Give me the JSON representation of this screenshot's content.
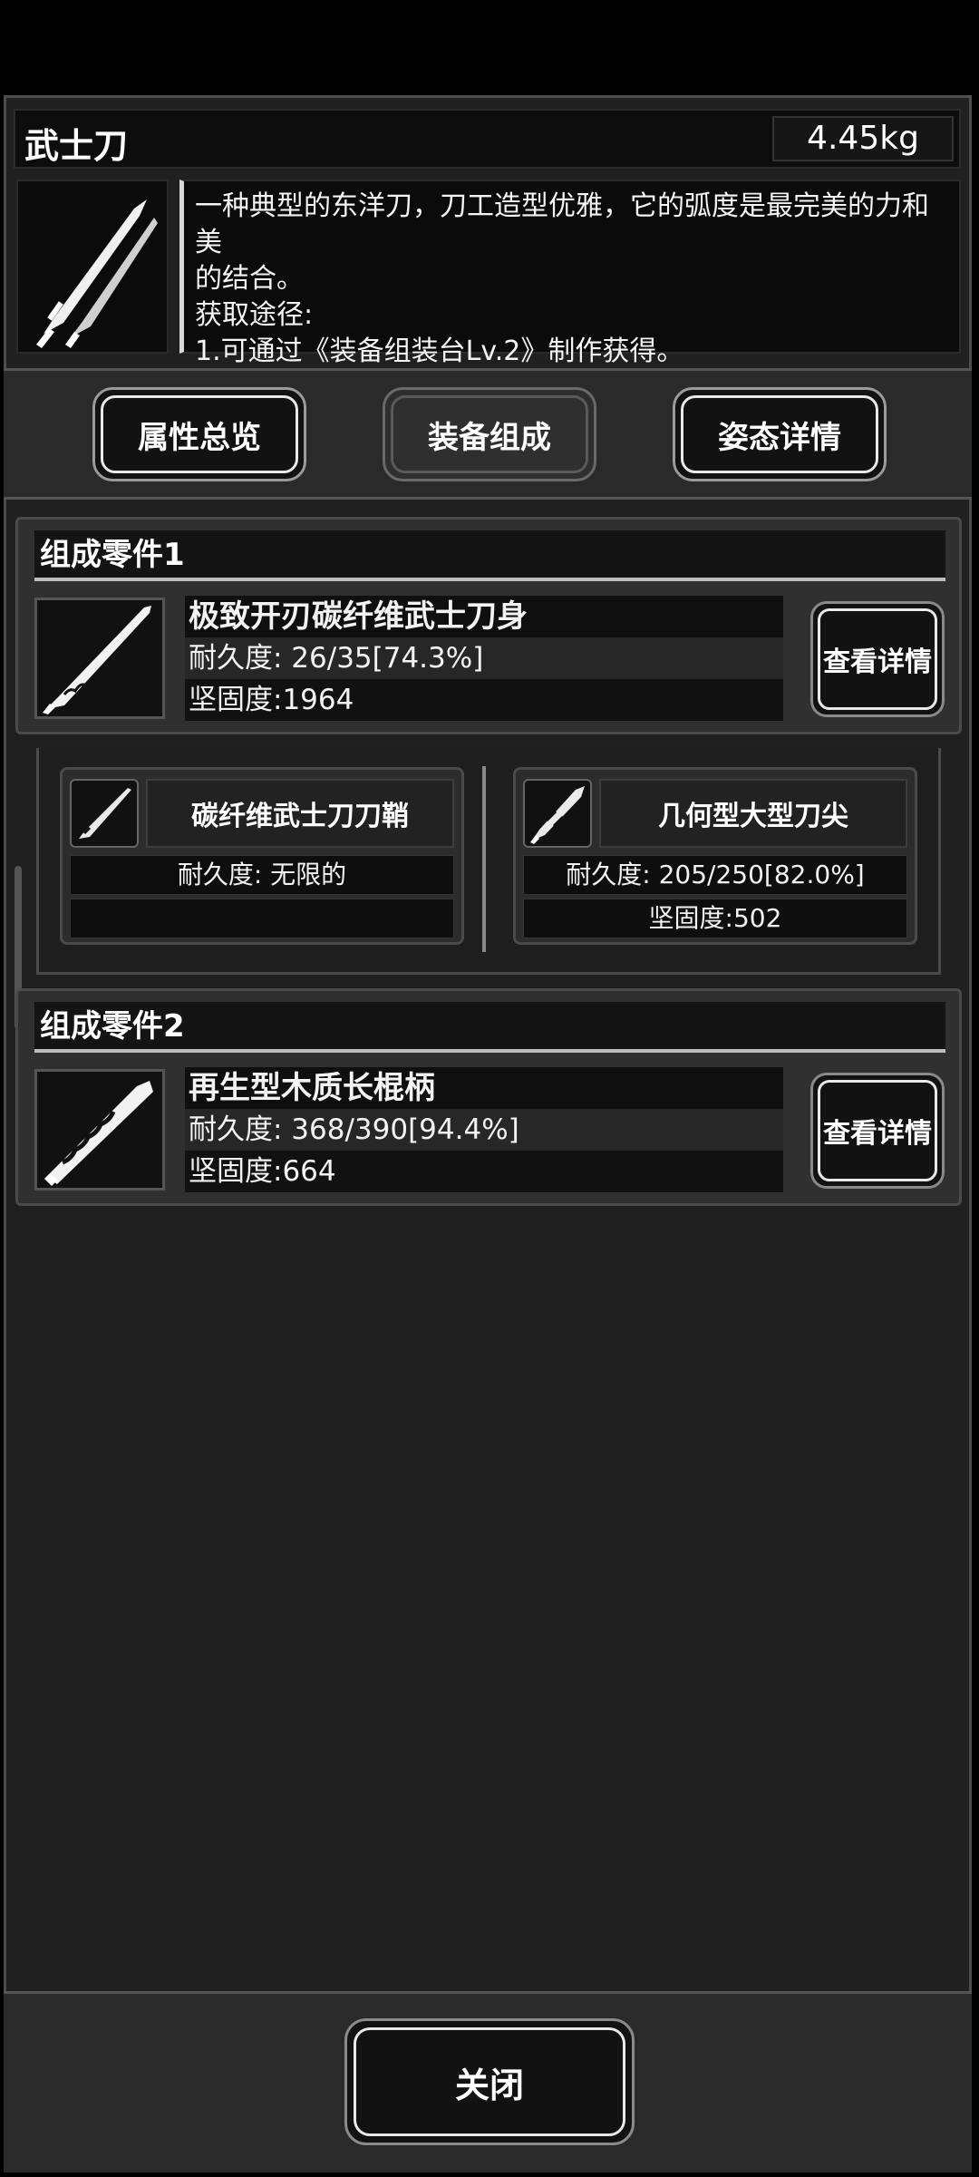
{
  "item": {
    "name": "武士刀",
    "weight": "4.45kg",
    "icon": "katana-icon",
    "description_lines": [
      "一种典型的东洋刀，刀工造型优雅，它的弧度是最完美的力和美",
      "的结合。",
      "获取途径:",
      "1.可通过《装备组装台Lv.2》制作获得。"
    ]
  },
  "tabs": [
    {
      "label": "属性总览"
    },
    {
      "label": "装备组成"
    },
    {
      "label": "姿态详情"
    }
  ],
  "parts": [
    {
      "header": "组成零件1",
      "icon": "blade-icon",
      "name": "极致开刃碳纤维武士刀身",
      "durability": "耐久度: 26/35[74.3%]",
      "hardness": "坚固度:1964",
      "detail_label": "查看详情"
    },
    {
      "header": "组成零件2",
      "icon": "handle-icon",
      "name": "再生型木质长棍柄",
      "durability": "耐久度: 368/390[94.4%]",
      "hardness": "坚固度:664",
      "detail_label": "查看详情"
    }
  ],
  "subparts": [
    {
      "icon": "scabbard-icon",
      "name": "碳纤维武士刀刀鞘",
      "durability": "耐久度: 无限的",
      "hardness": ""
    },
    {
      "icon": "blade-tip-icon",
      "name": "几何型大型刀尖",
      "durability": "耐久度: 205/250[82.0%]",
      "hardness": "坚固度:502"
    }
  ],
  "close_label": "关闭"
}
